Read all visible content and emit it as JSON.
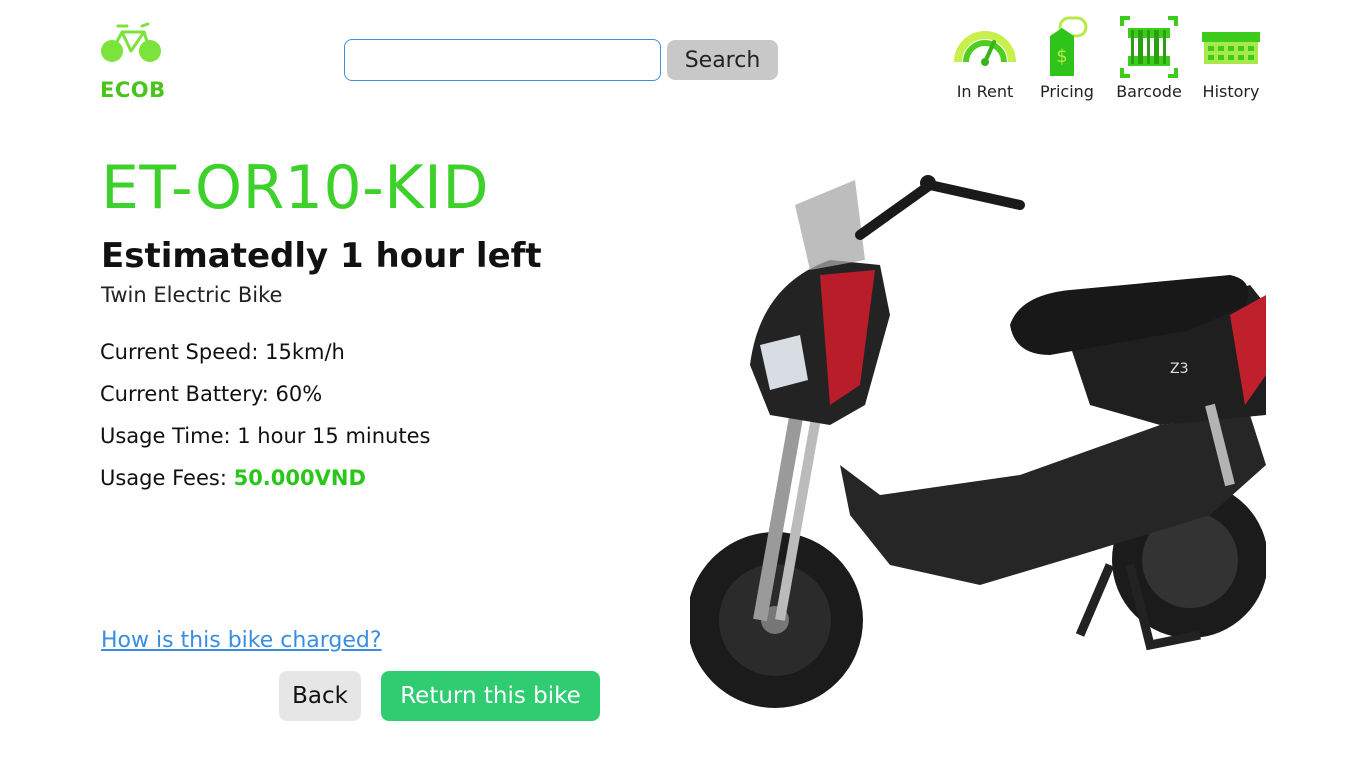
{
  "brand": {
    "name": "ECOB"
  },
  "search": {
    "placeholder": "",
    "value": "",
    "button_label": "Search"
  },
  "nav": {
    "items": [
      {
        "label": "In Rent",
        "icon": "speedometer-icon"
      },
      {
        "label": "Pricing",
        "icon": "price-tag-icon"
      },
      {
        "label": "Barcode",
        "icon": "barcode-icon"
      },
      {
        "label": "History",
        "icon": "history-table-icon"
      }
    ]
  },
  "bike": {
    "code": "ET-OR10-KID",
    "time_left": "Estimatedly 1 hour left",
    "type": "Twin Electric Bike",
    "image_alt": "electric scooter photo"
  },
  "details": {
    "speed": "Current Speed: 15km/h",
    "battery": "Current Battery: 60%",
    "usage_time": "Usage Time: 1 hour 15 minutes",
    "fees_label": "Usage Fees: ",
    "fees_value": "50.000VND"
  },
  "links": {
    "charge": "How is this bike charged?"
  },
  "actions": {
    "back_label": "Back",
    "return_label": "Return this bike"
  },
  "colors": {
    "accent_green": "#3fd12b",
    "return_button": "#2fcc71",
    "link_blue": "#3a8de0"
  }
}
